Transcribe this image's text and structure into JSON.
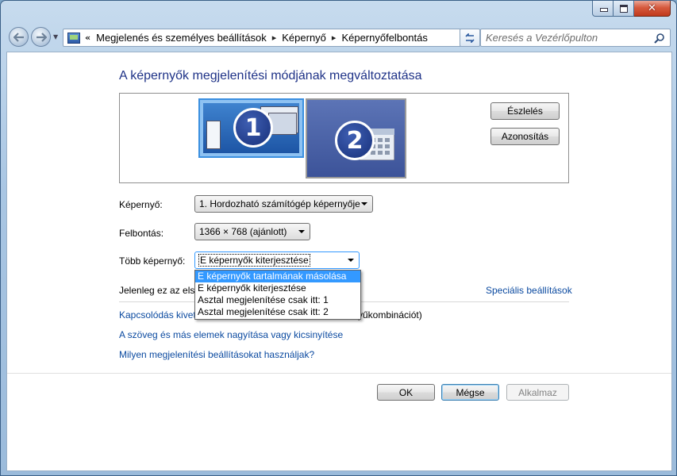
{
  "window": {
    "caption_buttons": {
      "minimize_icon": "minimize-icon",
      "maximize_icon": "maximize-icon",
      "close_icon": "close-icon",
      "close_glyph": "✕"
    }
  },
  "nav": {
    "back_icon": "back-arrow-icon",
    "forward_icon": "forward-arrow-icon",
    "breadcrumbs": [
      "Megjelenés és személyes beállítások",
      "Képernyő",
      "Képernyőfelbontás"
    ],
    "search_placeholder": "Keresés a Vezérlőpulton"
  },
  "main": {
    "title": "A képernyők megjelenítési módjának megváltoztatása",
    "monitors": [
      {
        "number": "1",
        "selected": true
      },
      {
        "number": "2",
        "selected": false
      }
    ],
    "detect_label": "Észlelés",
    "identify_label": "Azonosítás",
    "display_label": "Képernyő:",
    "display_value": "1. Hordozható számítógép képernyője",
    "resolution_label": "Felbontás:",
    "resolution_value": "1366 × 768 (ajánlott)",
    "multiple_label": "Több képernyő:",
    "multiple_value": "E képernyők kiterjesztése",
    "multiple_options": [
      "E képernyők tartalmának másolása",
      "E képernyők kiterjesztése",
      "Asztal megjelenítése csak itt: 1",
      "Asztal megjelenítése csak itt: 2"
    ],
    "multiple_highlighted_index": 0,
    "current_text": "Jelenleg ez az első",
    "special_settings_link": "Speciális beállítások",
    "projector_link": "Kapcsolódás kivet",
    "projector_suffix": "yűkombinációt)",
    "text_size_link": "A szöveg és más elemek nagyítása vagy kicsinyítése",
    "which_settings_link": "Milyen megjelenítési beállításokat használjak?"
  },
  "footer": {
    "ok_label": "OK",
    "cancel_label": "Mégse",
    "apply_label": "Alkalmaz"
  },
  "colors": {
    "title_blue": "#1e3287",
    "link_blue": "#0b4aa0",
    "selection_blue": "#3399ff"
  }
}
